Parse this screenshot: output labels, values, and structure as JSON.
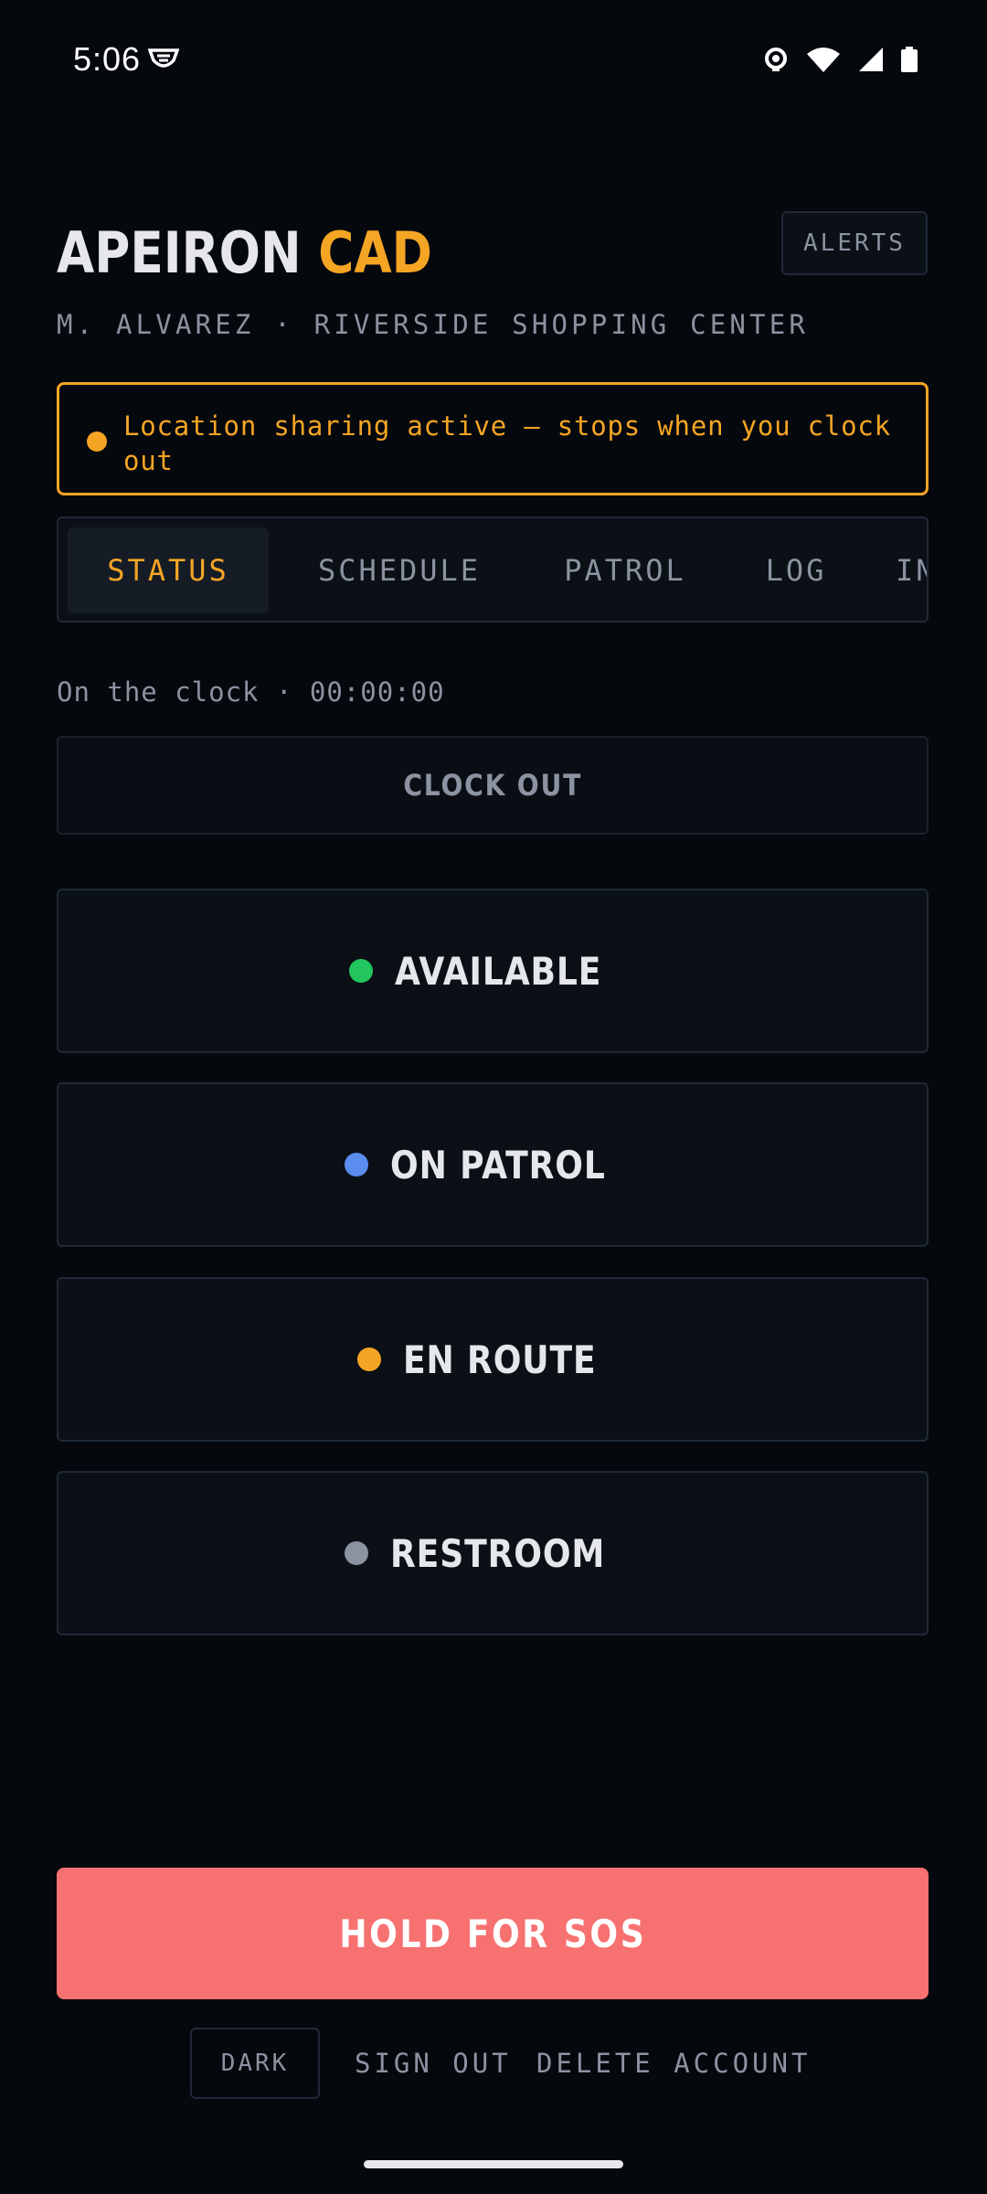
{
  "status_bar": {
    "time": "5:06"
  },
  "header": {
    "title_part1": "APEIRON",
    "title_part2": "CAD",
    "alerts_label": "ALERTS",
    "subtitle": "M. ALVAREZ · RIVERSIDE SHOPPING CENTER"
  },
  "banner": {
    "text": "Location sharing active — stops when you clock out"
  },
  "tabs": [
    {
      "label": "STATUS",
      "active": true
    },
    {
      "label": "SCHEDULE",
      "active": false
    },
    {
      "label": "PATROL",
      "active": false
    },
    {
      "label": "LOG",
      "active": false
    },
    {
      "label": "IN",
      "active": false
    }
  ],
  "clock": {
    "text": "On the clock · 00:00:00",
    "button_label": "CLOCK OUT"
  },
  "statuses": [
    {
      "label": "AVAILABLE",
      "color": "#22c55e"
    },
    {
      "label": "ON PATROL",
      "color": "#5b8def"
    },
    {
      "label": "EN ROUTE",
      "color": "#f5a524"
    },
    {
      "label": "RESTROOM",
      "color": "#8b93a1"
    }
  ],
  "sos": {
    "label": "HOLD FOR SOS"
  },
  "footer": {
    "theme_label": "DARK",
    "sign_out_label": "SIGN OUT",
    "delete_label": "DELETE ACCOUNT"
  },
  "colors": {
    "accent": "#f5a524",
    "sos": "#f87171",
    "background": "#05080d"
  }
}
